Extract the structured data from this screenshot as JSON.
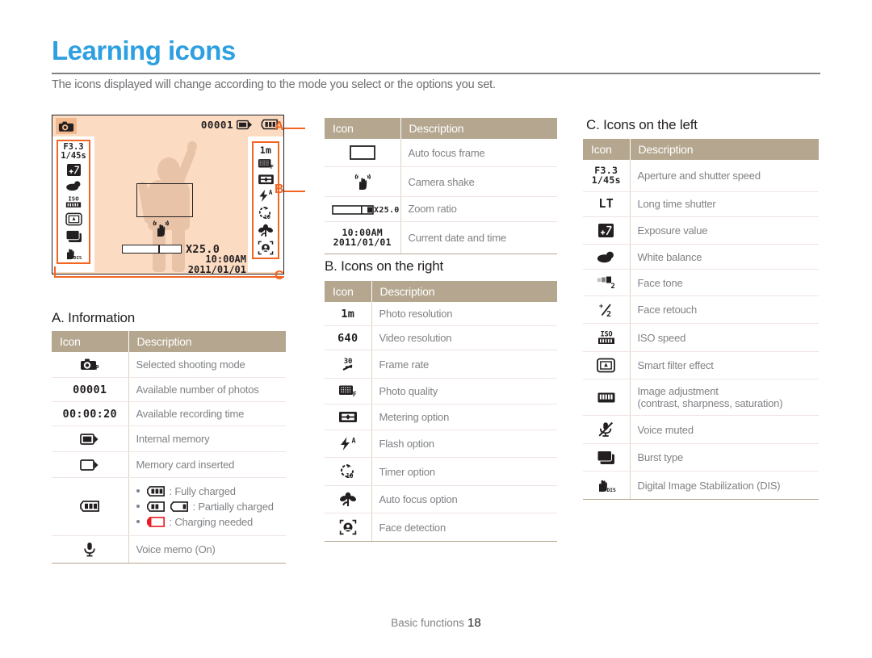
{
  "page": {
    "title": "Learning icons",
    "intro": "The icons displayed will change according to the mode you select or the options you set.",
    "footer_label": "Basic functions",
    "footer_page": "18",
    "accent_color": "#2e9fe0",
    "callout_color": "#f26522",
    "table_header_color": "#b5a78f",
    "screen_bg_color": "#fbdcc3"
  },
  "camera_screen": {
    "mode_icon": "camera-program-mode-icon",
    "available_photos": "00001",
    "memory_icon": "internal-memory-icon",
    "battery_icon": "battery-full-icon",
    "left_column": [
      {
        "icon": "aperture-shutter-icon",
        "line1": "F3.3",
        "line2": "1/45s"
      },
      {
        "icon": "exposure-value-icon"
      },
      {
        "icon": "white-balance-cloudy-icon"
      },
      {
        "icon": "iso-speed-icon"
      },
      {
        "icon": "smart-filter-icon"
      },
      {
        "icon": "burst-type-icon"
      },
      {
        "icon": "dis-stabilization-icon"
      }
    ],
    "right_column": [
      {
        "icon": "photo-resolution-icon",
        "label": "1m"
      },
      {
        "icon": "photo-quality-icon"
      },
      {
        "icon": "metering-option-icon"
      },
      {
        "icon": "flash-auto-icon"
      },
      {
        "icon": "timer-10s-icon"
      },
      {
        "icon": "auto-focus-macro-icon"
      },
      {
        "icon": "face-detection-icon"
      }
    ],
    "center": {
      "af_frame": "auto-focus-frame",
      "shake_icon": "camera-shake-icon",
      "zoom_ratio": "X25.0",
      "time": "10:00AM",
      "date": "2011/01/01"
    },
    "callouts": [
      {
        "label": "A"
      },
      {
        "label": "B"
      },
      {
        "label": "C"
      }
    ]
  },
  "tables": {
    "headers": {
      "icon": "Icon",
      "description": "Description"
    },
    "section_a": {
      "title": "A. Information",
      "rows": [
        {
          "icon": "camera-program-mode-icon",
          "text": "Selected shooting mode"
        },
        {
          "icon": "photo-count-text",
          "icon_text": "00001",
          "text": "Available number of photos"
        },
        {
          "icon": "recording-time-text",
          "icon_text": "00:00:20",
          "text": "Available recording time"
        },
        {
          "icon": "internal-memory-icon",
          "text": "Internal memory"
        },
        {
          "icon": "memory-card-icon",
          "text": "Memory card inserted"
        },
        {
          "icon": "battery-full-icon",
          "text": "",
          "battery_states": [
            {
              "icon": "battery-full-icon",
              "text": ": Fully charged"
            },
            {
              "icon": "battery-partial-icon",
              "text": ": Partially charged"
            },
            {
              "icon": "battery-empty-icon",
              "text": ": Charging needed"
            }
          ]
        },
        {
          "icon": "voice-memo-icon",
          "text": "Voice memo (On)"
        }
      ]
    },
    "section_top_middle": {
      "rows": [
        {
          "icon": "auto-focus-frame-icon",
          "text": "Auto focus frame"
        },
        {
          "icon": "camera-shake-icon",
          "text": "Camera shake"
        },
        {
          "icon": "zoom-ratio-icon",
          "icon_text": "X25.0",
          "text": "Zoom ratio"
        },
        {
          "icon": "date-time-icon",
          "icon_text_1": "10:00AM",
          "icon_text_2": "2011/01/01",
          "text": "Current date and time"
        }
      ]
    },
    "section_b": {
      "title": "B. Icons on the right",
      "rows": [
        {
          "icon": "photo-resolution-icon",
          "icon_text": "1m",
          "text": "Photo resolution"
        },
        {
          "icon": "video-resolution-icon",
          "icon_text": "640",
          "text": "Video resolution"
        },
        {
          "icon": "frame-rate-icon",
          "text": "Frame rate"
        },
        {
          "icon": "photo-quality-icon",
          "text": "Photo quality"
        },
        {
          "icon": "metering-option-icon",
          "text": "Metering option"
        },
        {
          "icon": "flash-auto-icon",
          "text": "Flash option"
        },
        {
          "icon": "timer-10s-icon",
          "text": "Timer option"
        },
        {
          "icon": "auto-focus-macro-icon",
          "text": "Auto focus option"
        },
        {
          "icon": "face-detection-icon",
          "text": "Face detection"
        }
      ]
    },
    "section_c": {
      "title": "C. Icons on the left",
      "rows": [
        {
          "icon": "aperture-shutter-icon",
          "icon_text_1": "F3.3",
          "icon_text_2": "1/45s",
          "text": "Aperture and shutter speed"
        },
        {
          "icon": "long-time-shutter-icon",
          "icon_text": "LT",
          "text": "Long time shutter"
        },
        {
          "icon": "exposure-value-icon",
          "text": "Exposure value"
        },
        {
          "icon": "white-balance-cloudy-icon",
          "text": "White balance"
        },
        {
          "icon": "face-tone-icon",
          "text": "Face tone"
        },
        {
          "icon": "face-retouch-icon",
          "text": "Face retouch"
        },
        {
          "icon": "iso-speed-icon",
          "text": "ISO speed"
        },
        {
          "icon": "smart-filter-icon",
          "text": "Smart filter effect"
        },
        {
          "icon": "image-adjustment-icon",
          "text": "Image adjustment",
          "text2": "(contrast, sharpness, saturation)"
        },
        {
          "icon": "voice-muted-icon",
          "text": "Voice muted"
        },
        {
          "icon": "burst-type-icon",
          "text": "Burst type"
        },
        {
          "icon": "dis-stabilization-icon",
          "text": "Digital Image Stabilization (DIS)"
        }
      ]
    }
  }
}
